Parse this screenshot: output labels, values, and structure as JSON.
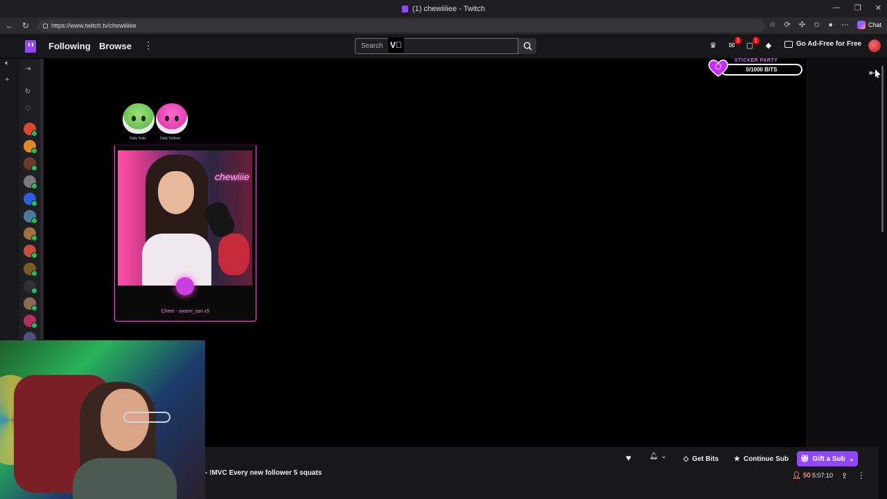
{
  "browser": {
    "tab_title": "(1) chewiiiiee - Twitch",
    "url": "https://www.twitch.tv/chewiiiiee",
    "chat_label": "Chat",
    "window_controls": [
      "—",
      "❐",
      "✕"
    ]
  },
  "topnav": {
    "following_label": "Following",
    "browse_label": "Browse",
    "more_icon": "⋮",
    "search_placeholder": "Search",
    "search_overlay_text": "V⃞",
    "inbox_badge": "3",
    "whispers_badge": "1",
    "ad_free_label": "Go Ad-Free for Free"
  },
  "sticker_party": {
    "title": "STICKER PARTY",
    "progress": "0/1000 BITS",
    "fill": 0
  },
  "overlay": {
    "daily_left_caption": "Daily Subs",
    "daily_right_caption": "Daily Follows",
    "neon_sign": "chewiiie",
    "cheer_text": "Cheer - swami_san x5"
  },
  "infobar": {
    "stream_title": "- !MVC Every new follower 5 squats",
    "get_bits_label": "Get Bits",
    "continue_sub_label": "Continue Sub",
    "gift_sub_label": "Gift a Sub",
    "viewer_count": "50",
    "uptime": "5:07:10"
  },
  "colors": {
    "twitch_purple": "#9147ff",
    "live_green": "#1fbf5c",
    "viewer_red": "#ff8280",
    "overlay_pink": "#ff4fd8"
  },
  "sidebar": {
    "channels": [
      {
        "color": "#d7482f"
      },
      {
        "color": "#e08a2b"
      },
      {
        "color": "#6b3b2a"
      },
      {
        "color": "#7a7a7a"
      },
      {
        "color": "#2b5fd7"
      },
      {
        "color": "#4a7b9d"
      },
      {
        "color": "#a07040"
      },
      {
        "color": "#c0503a"
      },
      {
        "color": "#7a5a20"
      },
      {
        "color": "#303030"
      },
      {
        "color": "#8a6a50"
      },
      {
        "color": "#b03060"
      },
      {
        "color": "#505080"
      }
    ]
  }
}
